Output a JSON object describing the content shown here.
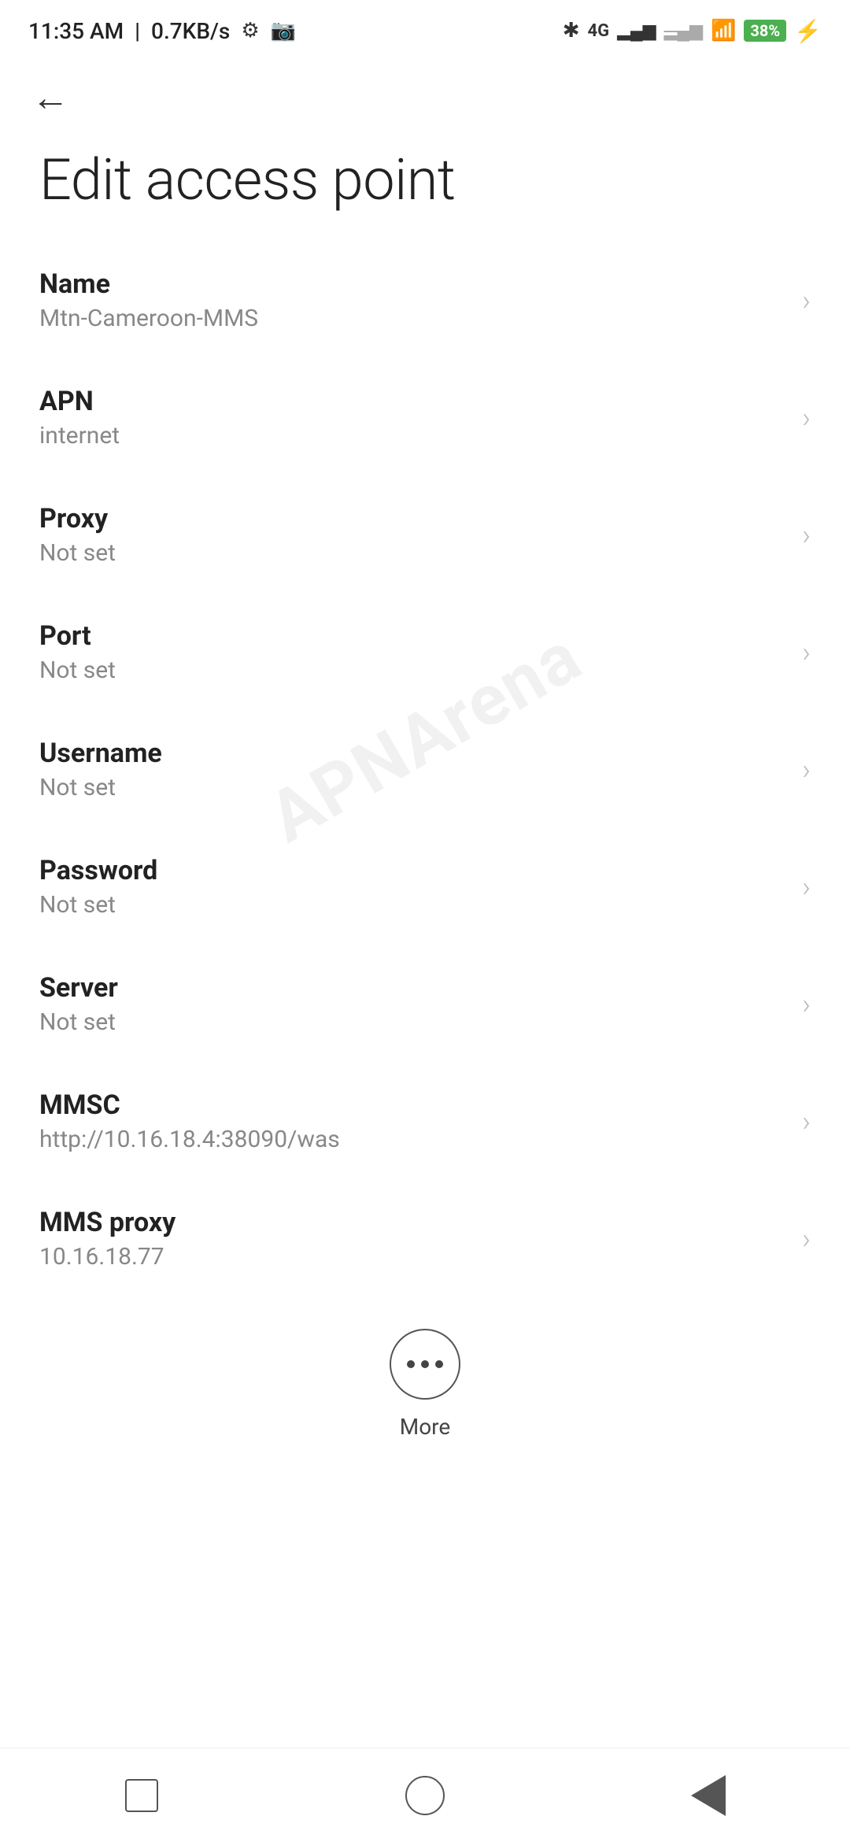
{
  "statusBar": {
    "time": "11:35 AM",
    "speed": "0.7KB/s",
    "battery": "38"
  },
  "toolbar": {
    "backLabel": "←"
  },
  "page": {
    "title": "Edit access point"
  },
  "settings": [
    {
      "id": "name",
      "label": "Name",
      "value": "Mtn-Cameroon-MMS"
    },
    {
      "id": "apn",
      "label": "APN",
      "value": "internet"
    },
    {
      "id": "proxy",
      "label": "Proxy",
      "value": "Not set"
    },
    {
      "id": "port",
      "label": "Port",
      "value": "Not set"
    },
    {
      "id": "username",
      "label": "Username",
      "value": "Not set"
    },
    {
      "id": "password",
      "label": "Password",
      "value": "Not set"
    },
    {
      "id": "server",
      "label": "Server",
      "value": "Not set"
    },
    {
      "id": "mmsc",
      "label": "MMSC",
      "value": "http://10.16.18.4:38090/was"
    },
    {
      "id": "mms-proxy",
      "label": "MMS proxy",
      "value": "10.16.18.77"
    }
  ],
  "bottomAction": {
    "moreLabel": "More"
  },
  "watermark": "APNArena"
}
